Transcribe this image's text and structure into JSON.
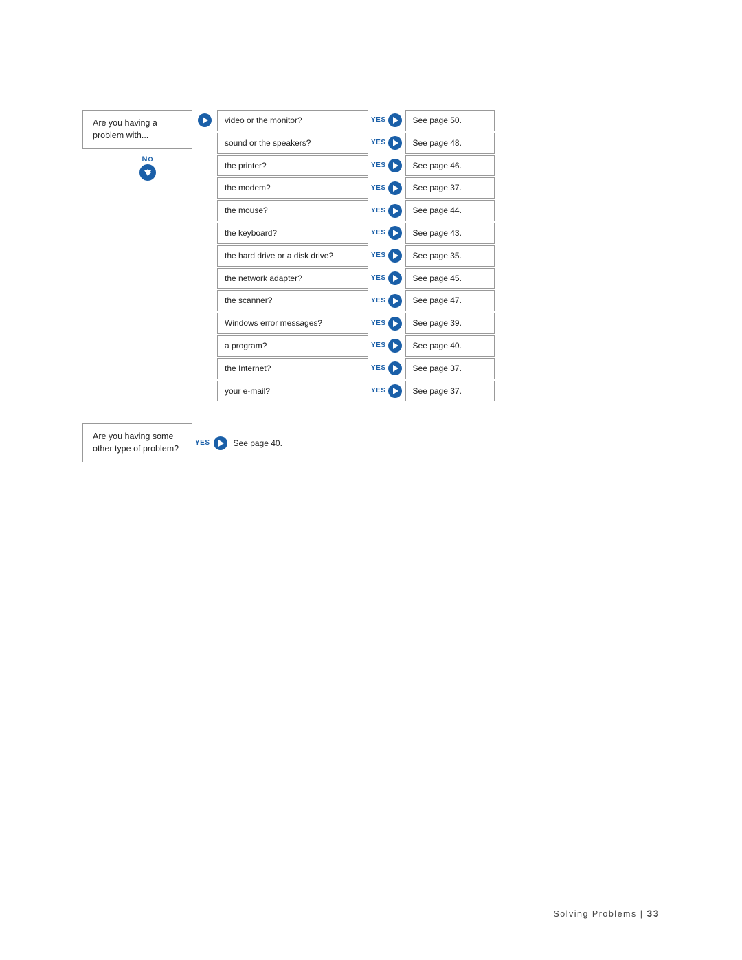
{
  "main_question": {
    "text": "Are you having a problem with..."
  },
  "no_label": "NO",
  "items": [
    {
      "question": "video or the monitor?",
      "yes_result": "See page 50."
    },
    {
      "question": "sound or the speakers?",
      "yes_result": "See page 48."
    },
    {
      "question": "the printer?",
      "yes_result": "See page 46."
    },
    {
      "question": "the modem?",
      "yes_result": "See page 37."
    },
    {
      "question": "the mouse?",
      "yes_result": "See page 44."
    },
    {
      "question": "the keyboard?",
      "yes_result": "See page 43."
    },
    {
      "question": "the hard drive or a disk drive?",
      "yes_result": "See page 35."
    },
    {
      "question": "the network adapter?",
      "yes_result": "See page 45."
    },
    {
      "question": "the scanner?",
      "yes_result": "See page 47."
    },
    {
      "question": "Windows error messages?",
      "yes_result": "See page 39."
    },
    {
      "question": "a program?",
      "yes_result": "See page 40."
    },
    {
      "question": "the Internet?",
      "yes_result": "See page 37."
    },
    {
      "question": "your e-mail?",
      "yes_result": "See page 37."
    }
  ],
  "bottom_question": {
    "text": "Are you having some other type of problem?"
  },
  "bottom_yes_result": "See page 40.",
  "footer": {
    "text": "Solving Problems",
    "separator": "|",
    "page_number": "33"
  },
  "yes_label": "YES"
}
